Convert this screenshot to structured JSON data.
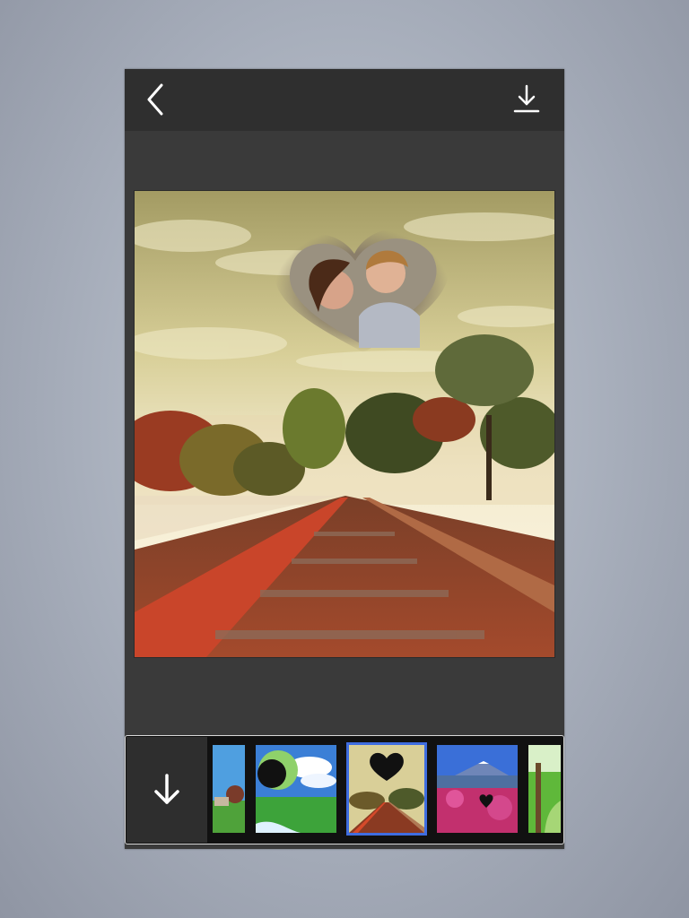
{
  "app": {
    "header": {
      "back_icon": "chevron-left-icon",
      "download_icon": "download-icon"
    },
    "editor": {
      "photo": "railway-tracks-with-heart-frame-couple"
    },
    "frame_strip": {
      "download_icon": "arrow-down-icon",
      "selected_index": 2,
      "thumbnails": [
        {
          "name": "meadow-house-frame"
        },
        {
          "name": "green-field-sky-frame"
        },
        {
          "name": "railway-heart-frame"
        },
        {
          "name": "mountain-flowers-frame"
        },
        {
          "name": "green-forest-frame"
        }
      ]
    },
    "colors": {
      "topbar": "#2f2f2f",
      "canvas": "#3a3a3a",
      "selection": "#3f6de0"
    }
  }
}
